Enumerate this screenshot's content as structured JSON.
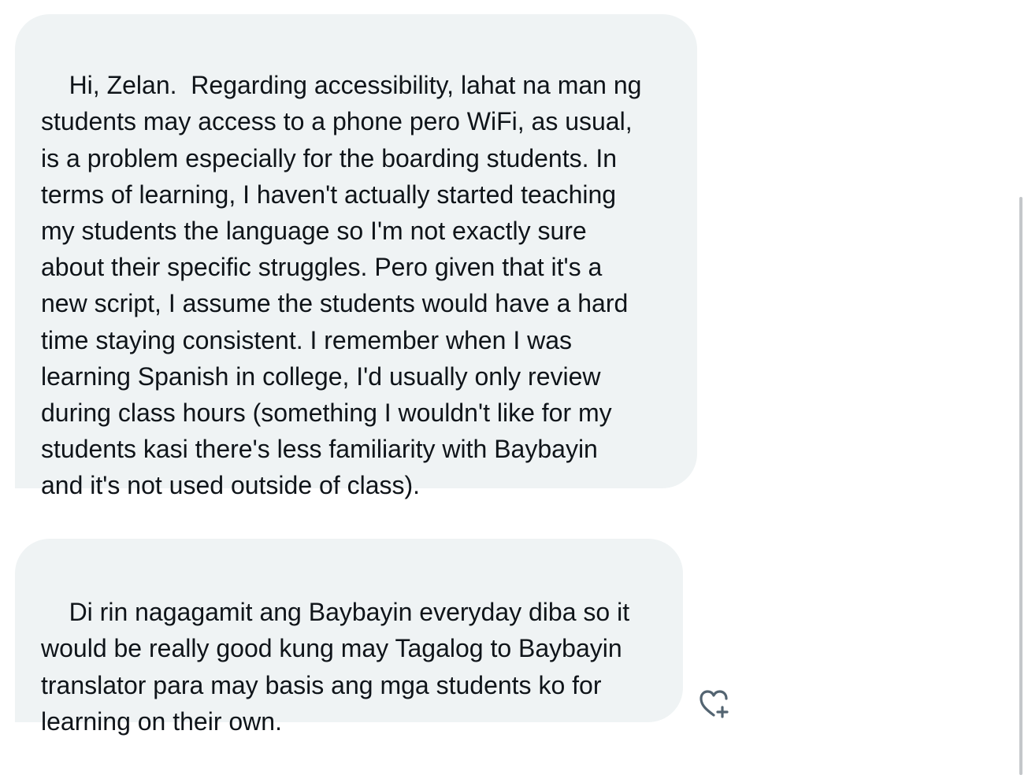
{
  "conversation": {
    "messages": [
      {
        "text": "Hi, Zelan.  Regarding accessibility, lahat na man ng\nstudents may access to a phone pero WiFi, as usual,\nis a problem especially for the boarding students. In\nterms of learning, I haven't actually started teaching\nmy students the language so I'm not exactly sure\nabout their specific struggles. Pero given that it's a\nnew script, I assume the students would have a hard\ntime staying consistent. I remember when I was\nlearning Spanish in college, I'd usually only review\nduring class hours (something I wouldn't like for my\nstudents kasi there's less familiarity with Baybayin\nand it's not used outside of class)."
      },
      {
        "text": "Di rin nagagamit ang Baybayin everyday diba so it\nwould be really good kung may Tagalog to Baybayin\ntranslator para may basis ang mga students ko for\nlearning on their own."
      }
    ],
    "reaction_icon": "heart-plus-icon"
  },
  "colors": {
    "bubble_bg": "#eff3f4",
    "text": "#0f1419",
    "icon": "#536471"
  }
}
